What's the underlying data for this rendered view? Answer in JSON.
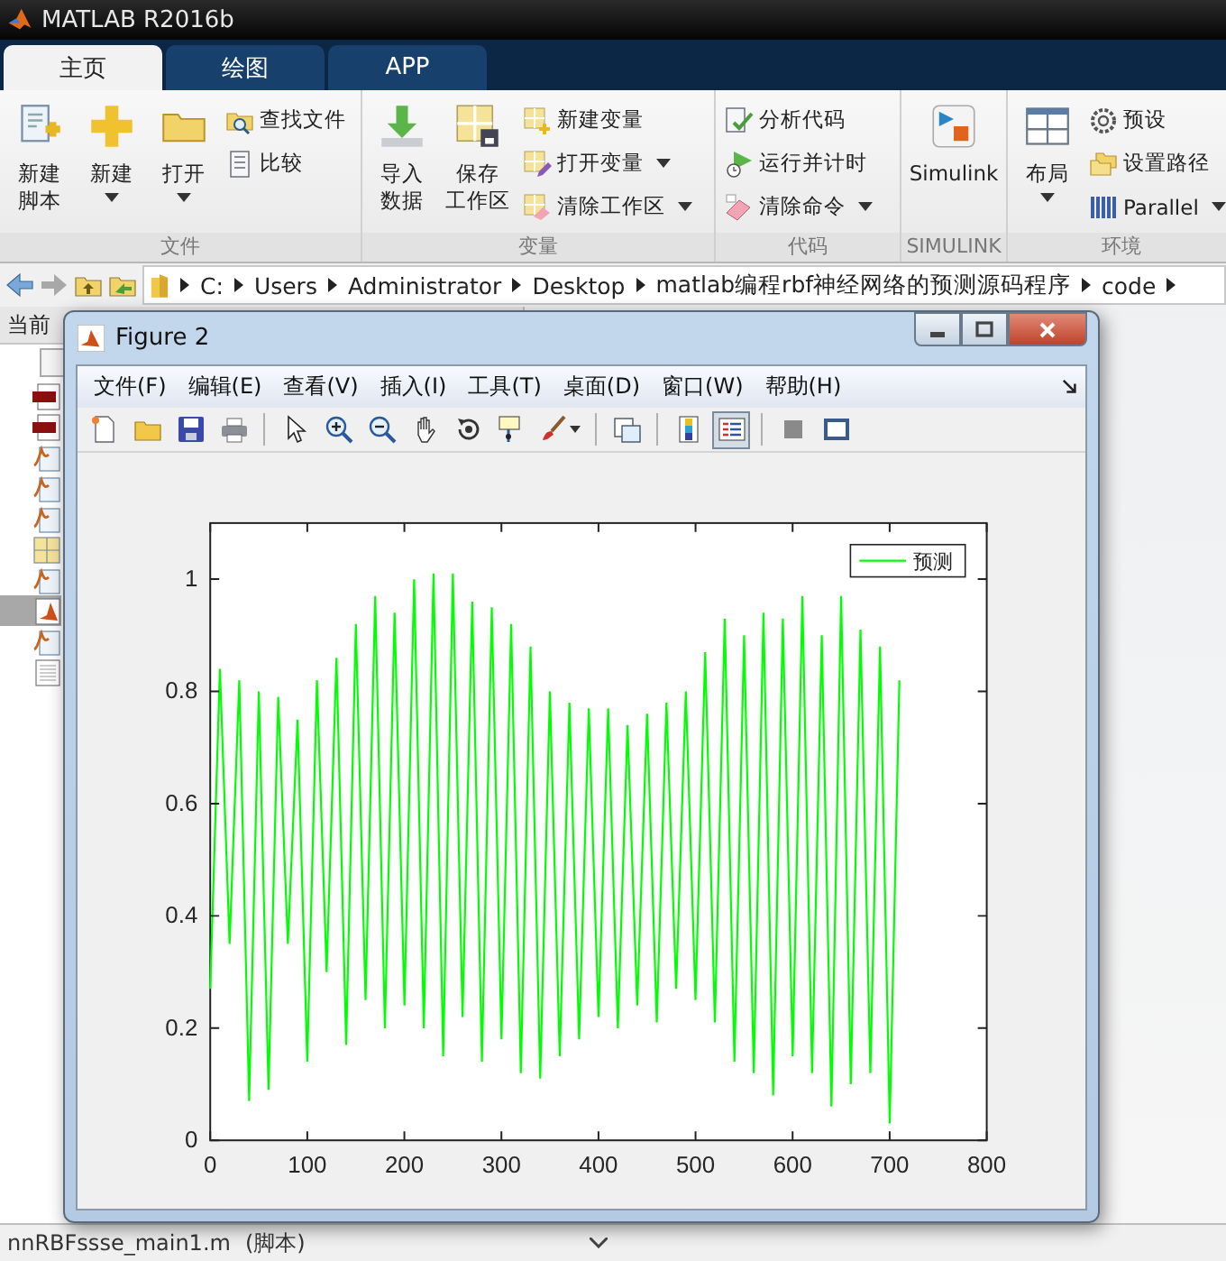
{
  "window": {
    "title": "MATLAB R2016b"
  },
  "tabs": [
    {
      "label": "主页",
      "selected": true
    },
    {
      "label": "绘图",
      "selected": false
    },
    {
      "label": "APP",
      "selected": false
    }
  ],
  "ribbon": {
    "groups": [
      {
        "label": "文件",
        "columns": [
          {
            "kind": "large",
            "lines": [
              "新建",
              "脚本"
            ],
            "dropdown": false
          },
          {
            "kind": "large",
            "lines": [
              "新建"
            ],
            "dropdown": true
          },
          {
            "kind": "large",
            "lines": [
              "打开"
            ],
            "dropdown": true
          },
          {
            "kind": "stack",
            "items": [
              {
                "label": "查找文件",
                "dropdown": false
              },
              {
                "label": "比较",
                "dropdown": false
              }
            ]
          }
        ]
      },
      {
        "label": "变量",
        "columns": [
          {
            "kind": "large",
            "lines": [
              "导入",
              "数据"
            ],
            "dropdown": false
          },
          {
            "kind": "large",
            "lines": [
              "保存",
              "工作区"
            ],
            "dropdown": false
          },
          {
            "kind": "stack",
            "items": [
              {
                "label": "新建变量",
                "dropdown": false
              },
              {
                "label": "打开变量",
                "dropdown": true
              },
              {
                "label": "清除工作区",
                "dropdown": true
              }
            ]
          }
        ]
      },
      {
        "label": "代码",
        "columns": [
          {
            "kind": "stack",
            "items": [
              {
                "label": "分析代码",
                "dropdown": false
              },
              {
                "label": "运行并计时",
                "dropdown": false
              },
              {
                "label": "清除命令",
                "dropdown": true
              }
            ]
          }
        ]
      },
      {
        "label": "SIMULINK",
        "columns": [
          {
            "kind": "large",
            "lines": [
              "Simulink"
            ],
            "dropdown": false
          }
        ]
      },
      {
        "label": "环境",
        "columns": [
          {
            "kind": "large",
            "lines": [
              "布局"
            ],
            "dropdown": true
          },
          {
            "kind": "stack",
            "items": [
              {
                "label": "预设",
                "dropdown": false
              },
              {
                "label": "设置路径",
                "dropdown": false
              },
              {
                "label": "Parallel",
                "dropdown": true
              }
            ]
          }
        ]
      }
    ]
  },
  "address_bar": {
    "path": [
      "C:",
      "Users",
      "Administrator",
      "Desktop",
      "matlab编程rbf神经网络的预测源码程序",
      "code"
    ]
  },
  "current_folder": {
    "title": "当前",
    "files": [
      {
        "kind": "png",
        "selected": false
      },
      {
        "kind": "png",
        "selected": false
      },
      {
        "kind": "m",
        "selected": false
      },
      {
        "kind": "m",
        "selected": false
      },
      {
        "kind": "m",
        "selected": false
      },
      {
        "kind": "grid",
        "selected": false
      },
      {
        "kind": "m",
        "selected": false
      },
      {
        "kind": "fig",
        "selected": true
      },
      {
        "kind": "m",
        "selected": false
      },
      {
        "kind": "text",
        "selected": false
      }
    ]
  },
  "status_bar": {
    "file": "nnRBFssse_main1.m",
    "type": "(脚本)"
  },
  "figure": {
    "title": "Figure 2",
    "menu": [
      "文件(F)",
      "编辑(E)",
      "查看(V)",
      "插入(I)",
      "工具(T)",
      "桌面(D)",
      "窗口(W)",
      "帮助(H)"
    ],
    "toolbar": [
      {
        "pressed": false
      },
      {
        "pressed": false
      },
      {
        "pressed": false
      },
      {
        "pressed": false
      },
      {
        "pressed": false
      },
      {
        "pressed": false
      },
      {
        "pressed": false
      },
      {
        "pressed": false
      },
      {
        "pressed": false
      },
      {
        "pressed": false
      },
      {
        "pressed": false
      },
      {
        "pressed": false
      },
      {
        "pressed": false
      },
      {
        "pressed": true
      },
      {
        "pressed": false
      },
      {
        "pressed": false
      }
    ],
    "chart_data": {
      "type": "line",
      "xlim": [
        0,
        800
      ],
      "ylim": [
        0,
        1.1
      ],
      "xticks": [
        0,
        100,
        200,
        300,
        400,
        500,
        600,
        700,
        800
      ],
      "yticks": [
        0,
        0.2,
        0.4,
        0.6,
        0.8,
        1
      ],
      "x": [
        0,
        10,
        20,
        30,
        40,
        50,
        60,
        70,
        80,
        90,
        100,
        110,
        120,
        130,
        140,
        150,
        160,
        170,
        180,
        190,
        200,
        210,
        220,
        230,
        240,
        250,
        260,
        270,
        280,
        290,
        300,
        310,
        320,
        330,
        340,
        350,
        360,
        370,
        380,
        390,
        400,
        410,
        420,
        430,
        440,
        450,
        460,
        470,
        480,
        490,
        500,
        510,
        520,
        530,
        540,
        550,
        560,
        570,
        580,
        590,
        600,
        610,
        620,
        630,
        640,
        650,
        660,
        670,
        680,
        690,
        700,
        710
      ],
      "series": [
        {
          "name": "预测",
          "color": "#00ff00",
          "values": [
            0.27,
            0.84,
            0.35,
            0.82,
            0.07,
            0.8,
            0.09,
            0.79,
            0.35,
            0.75,
            0.14,
            0.82,
            0.3,
            0.86,
            0.17,
            0.92,
            0.25,
            0.97,
            0.2,
            0.94,
            0.24,
            1.0,
            0.2,
            1.01,
            0.15,
            1.01,
            0.22,
            0.96,
            0.14,
            0.95,
            0.18,
            0.92,
            0.12,
            0.88,
            0.11,
            0.8,
            0.15,
            0.78,
            0.18,
            0.77,
            0.22,
            0.77,
            0.2,
            0.74,
            0.24,
            0.76,
            0.21,
            0.78,
            0.27,
            0.8,
            0.25,
            0.87,
            0.21,
            0.93,
            0.14,
            0.9,
            0.12,
            0.94,
            0.08,
            0.93,
            0.15,
            0.97,
            0.12,
            0.9,
            0.06,
            0.97,
            0.1,
            0.91,
            0.12,
            0.88,
            0.03,
            0.82
          ]
        }
      ]
    }
  }
}
